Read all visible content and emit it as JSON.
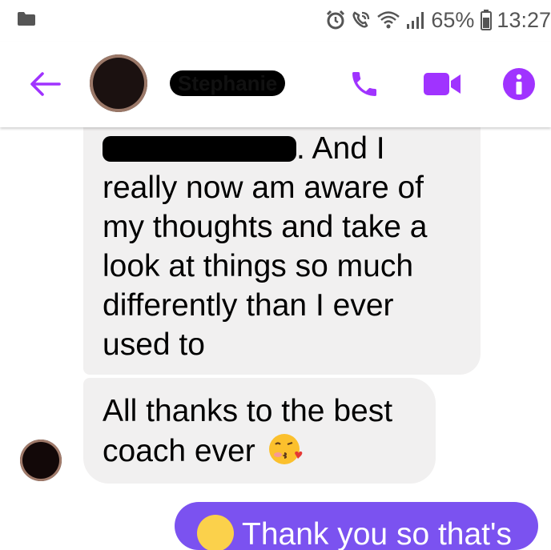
{
  "status_bar": {
    "battery_percent": "65%",
    "time": "13:27",
    "icons": [
      "folder-icon",
      "alarm-icon",
      "wifi-call-icon",
      "wifi-icon",
      "signal-icon",
      "battery-icon"
    ]
  },
  "header": {
    "back_icon": "back-arrow-icon",
    "contact_name": "Stephanie",
    "actions": [
      "phone-icon",
      "video-camera-icon",
      "info-icon"
    ],
    "accent_color": "#a033ff"
  },
  "messages": {
    "received_1_text": ". And I really now am aware of my thoughts and take a look at things so much differently than I ever used to",
    "received_2_text": "All thanks to the best coach ever",
    "received_2_emoji": "face-blowing-kiss-emoji",
    "sent_1_text": "Thank you so that's"
  },
  "colors": {
    "incoming_bubble": "#f1f0f0",
    "outgoing_bubble": "#7b52f0"
  }
}
